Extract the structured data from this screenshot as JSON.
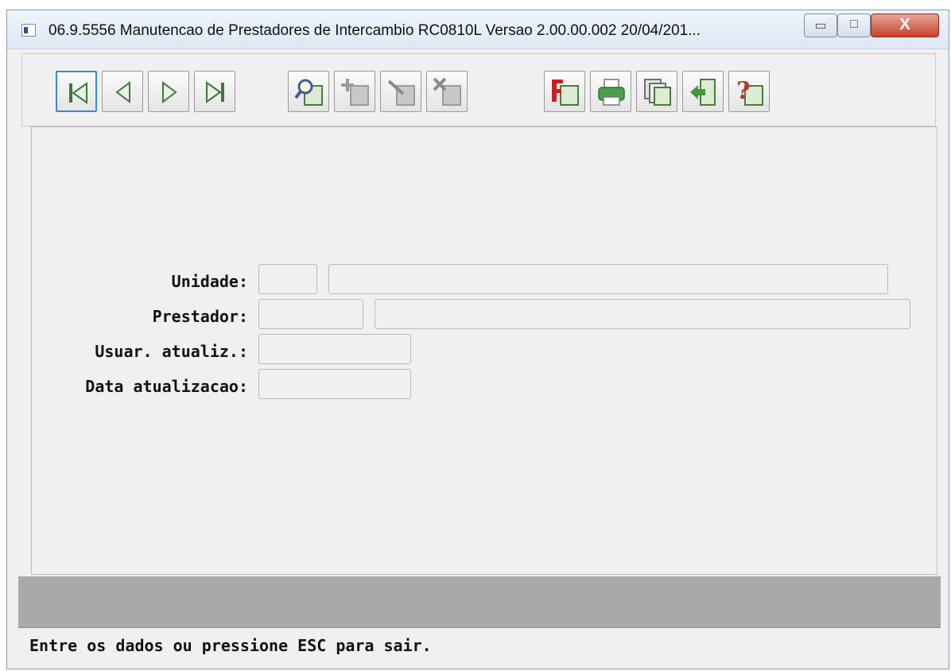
{
  "window": {
    "title": "06.9.5556 Manutencao de Prestadores de Intercambio RC0810L Versao 2.00.00.002 20/04/201...",
    "controls": {
      "minimize": "▭",
      "maximize": "□",
      "close": "X"
    }
  },
  "toolbar": {
    "buttons": [
      {
        "name": "first-record",
        "icon": "first-record-icon"
      },
      {
        "name": "previous-record",
        "icon": "previous-record-icon"
      },
      {
        "name": "next-record",
        "icon": "next-record-icon"
      },
      {
        "name": "last-record",
        "icon": "last-record-icon"
      },
      {
        "name": "search",
        "icon": "magnifier-icon"
      },
      {
        "name": "add",
        "icon": "add-icon"
      },
      {
        "name": "edit",
        "icon": "edit-icon"
      },
      {
        "name": "delete",
        "icon": "delete-icon"
      },
      {
        "name": "filter",
        "icon": "filter-icon"
      },
      {
        "name": "print",
        "icon": "printer-icon"
      },
      {
        "name": "copy",
        "icon": "copy-icon"
      },
      {
        "name": "exit",
        "icon": "exit-icon"
      },
      {
        "name": "help",
        "icon": "help-icon"
      }
    ]
  },
  "form": {
    "unidade": {
      "label": "Unidade:",
      "code": "",
      "description": ""
    },
    "prestador": {
      "label": "Prestador:",
      "code": "",
      "description": ""
    },
    "usuario": {
      "label": "Usuar. atualiz.:",
      "value": ""
    },
    "data": {
      "label": "Data atualizacao:",
      "value": ""
    }
  },
  "status": {
    "message": "Entre os dados ou pressione ESC para sair."
  }
}
